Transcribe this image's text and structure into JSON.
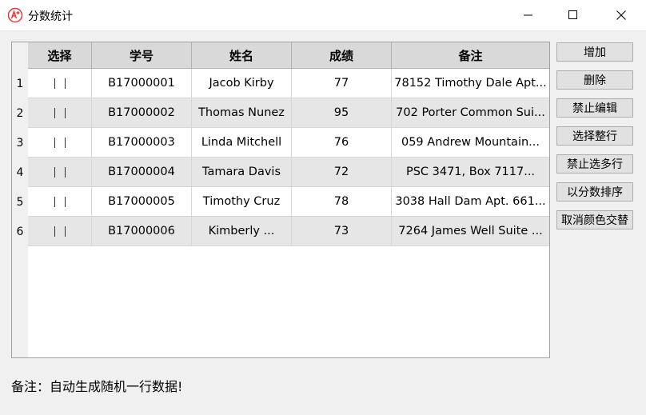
{
  "window": {
    "title": "分数统计",
    "icon": "grade-a-plus-icon",
    "controls": [
      "minimize-icon",
      "maximize-icon",
      "close-icon"
    ]
  },
  "table": {
    "headers": [
      "选择",
      "学号",
      "姓名",
      "成绩",
      "备注"
    ],
    "rows": [
      {
        "num": "1",
        "id": "B17000001",
        "name": "Jacob Kirby",
        "score": "77",
        "remark": "78152 Timothy Dale Apt..."
      },
      {
        "num": "2",
        "id": "B17000002",
        "name": "Thomas Nunez",
        "score": "95",
        "remark": "702 Porter Common Sui..."
      },
      {
        "num": "3",
        "id": "B17000003",
        "name": "Linda Mitchell",
        "score": "76",
        "remark": "059 Andrew Mountain..."
      },
      {
        "num": "4",
        "id": "B17000004",
        "name": "Tamara Davis",
        "score": "72",
        "remark": "PSC 3471, Box 7117..."
      },
      {
        "num": "5",
        "id": "B17000005",
        "name": "Timothy Cruz",
        "score": "78",
        "remark": "3038 Hall Dam Apt. 661..."
      },
      {
        "num": "6",
        "id": "B17000006",
        "name": "Kimberly ...",
        "score": "73",
        "remark": "7264 James Well Suite ..."
      }
    ]
  },
  "buttons": [
    "增加",
    "删除",
    "禁止编辑",
    "选择整行",
    "禁止选多行",
    "以分数排序",
    "取消颜色交替"
  ],
  "note": "备注：自动生成随机一行数据!",
  "colors": {
    "header_bg": "#d9d9d9",
    "alt_row_bg": "#e6e6e6",
    "icon_red": "#e53935"
  }
}
